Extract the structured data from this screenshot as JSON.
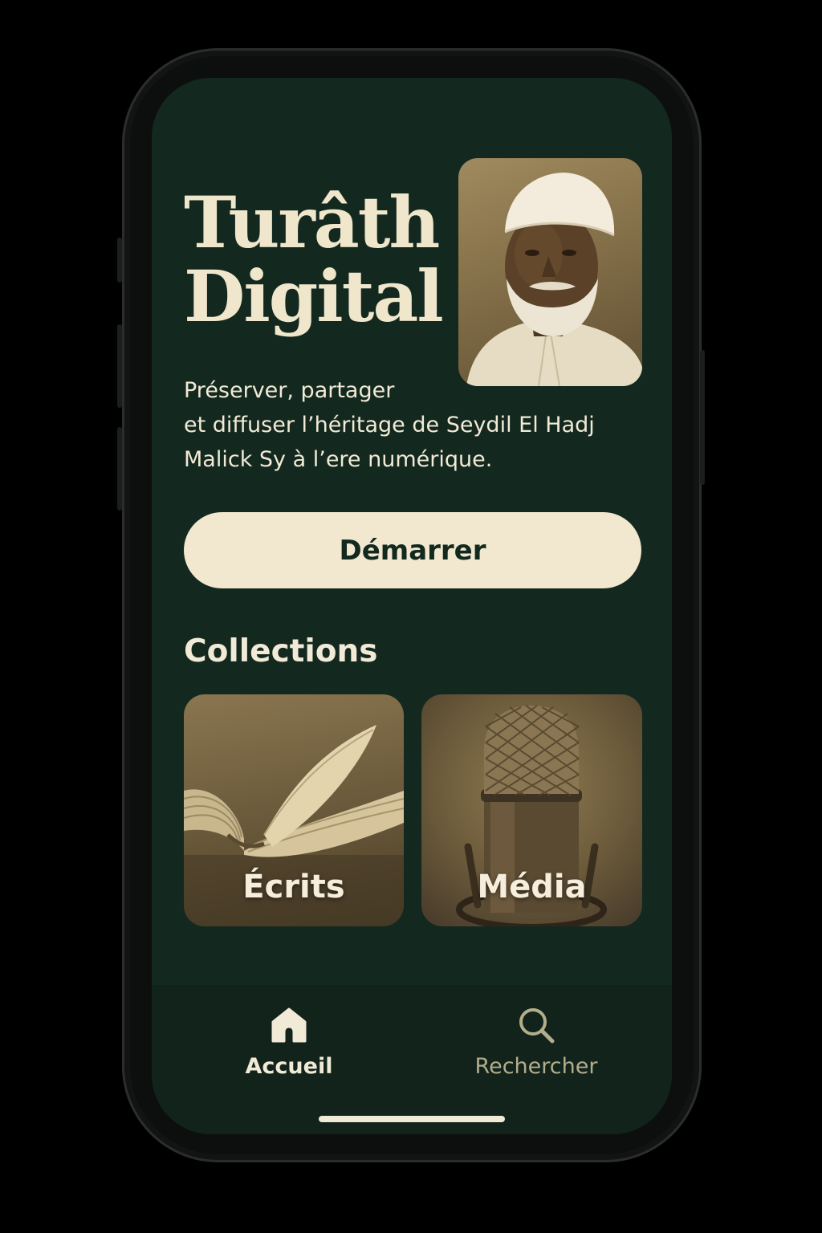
{
  "hero": {
    "title_line1": "Turâth",
    "title_line2": "Digital",
    "tagline_line1": "Préserver, partager",
    "tagline_line2": "et diffuser l’héritage de Seydil El Hadj",
    "tagline_line3": "Malick Sy à l’ere numérique."
  },
  "start_button": {
    "label": "Démarrer"
  },
  "collections": {
    "title": "Collections",
    "items": [
      {
        "label": "Écrits",
        "icon": "open-book-image"
      },
      {
        "label": "Média",
        "icon": "microphone-image"
      }
    ]
  },
  "tabbar": {
    "items": [
      {
        "label": "Accueil",
        "icon": "home-icon",
        "active": true
      },
      {
        "label": "Rechercher",
        "icon": "search-icon",
        "active": false
      }
    ]
  },
  "colors": {
    "background": "#13281f",
    "accent_cream": "#f1e8cf",
    "inactive_tab": "#b3ad8c",
    "sepia": "#8a7650"
  }
}
